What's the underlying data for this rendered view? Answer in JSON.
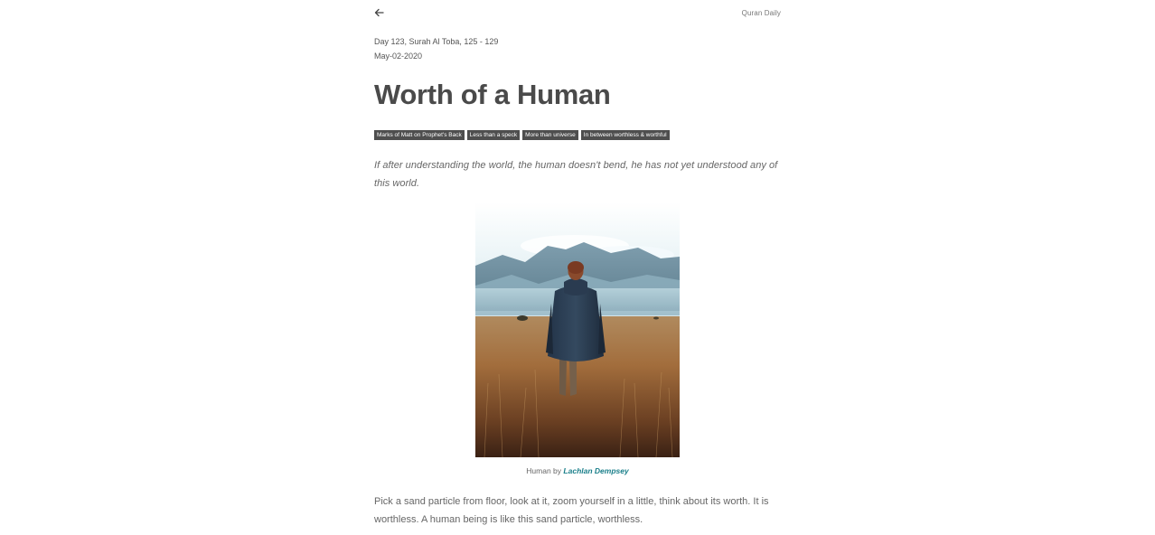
{
  "header": {
    "back_icon": "arrow-left-icon",
    "site_name": "Quran Daily"
  },
  "meta": {
    "reference": "Day 123, Surah Al Toba, 125 - 129",
    "date": "May-02-2020"
  },
  "article": {
    "title": "Worth of a Human",
    "tags": [
      "Marks of Matt on Prophet's Back",
      "Less than a speck",
      "More than universe",
      "In between worthless & worthful"
    ],
    "quote": "If after understanding the world, the human doesn't bend, he has not yet understood any of this world.",
    "figure": {
      "caption_prefix": "Human by",
      "caption_author": "Lachlan Dempsey"
    },
    "paragraphs": [
      "Pick a sand particle from floor, look at it, zoom yourself in a little, think about its worth. It is worthless. A human being is like this sand particle, worthless."
    ]
  },
  "colors": {
    "tag_bg": "#4e4e4e",
    "link": "#1a7f8a",
    "title": "#4a4a4a"
  }
}
